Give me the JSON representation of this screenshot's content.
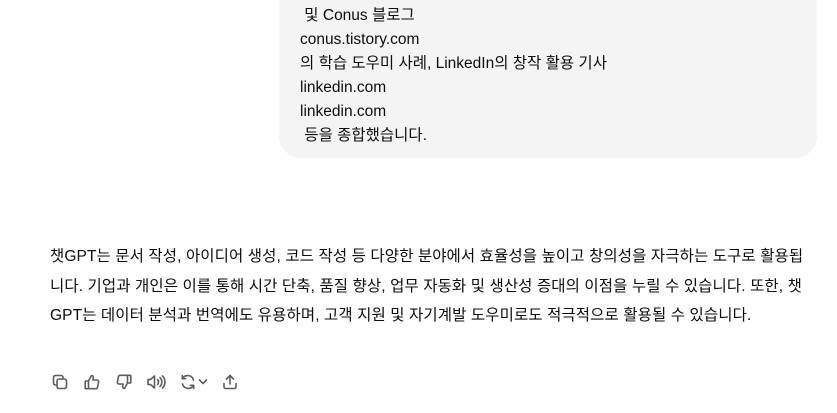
{
  "user_message": {
    "lines": [
      " 및 Conus 블로그",
      "conus.tistory.com",
      "의 학습 도우미 사례, LinkedIn의 창작 활용 기사",
      "linkedin.com",
      "linkedin.com",
      " 등을 종합했습니다."
    ]
  },
  "assistant_message": {
    "text": "챗GPT는 문서 작성, 아이디어 생성, 코드 작성 등 다양한 분야에서 효율성을 높이고 창의성을 자극하는 도구로 활용됩니다. 기업과 개인은 이를 통해 시간 단축, 품질 향상, 업무 자동화 및 생산성 증대의 이점을 누릴 수 있습니다. 또한, 챗GPT는 데이터 분석과 번역에도 유용하며, 고객 지원 및 자기계발 도우미로도 적극적으로 활용될 수 있습니다."
  },
  "action_bar": {
    "icons": [
      "copy-icon",
      "thumbs-up-icon",
      "thumbs-down-icon",
      "read-aloud-icon",
      "regenerate-icon",
      "share-icon"
    ]
  }
}
